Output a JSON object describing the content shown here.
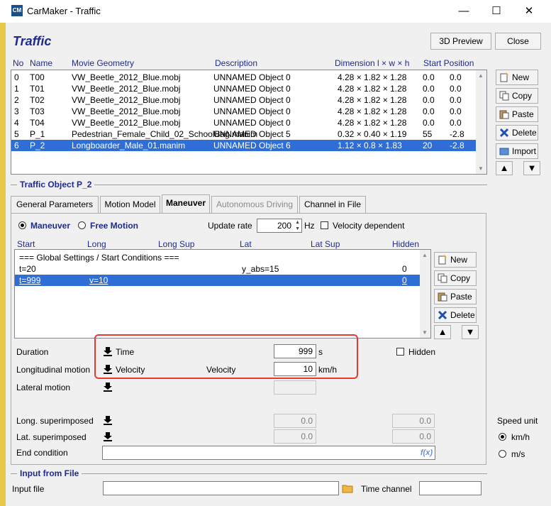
{
  "window": {
    "app_icon_text": "CM",
    "title": "CarMaker - Traffic",
    "minimize": "—",
    "maximize": "☐",
    "close": "✕"
  },
  "header": {
    "title": "Traffic",
    "preview_button": "3D Preview",
    "close_button": "Close"
  },
  "object_list": {
    "columns": [
      "No",
      "Name",
      "Movie Geometry",
      "Description",
      "Dimension l × w × h",
      "Start Position"
    ],
    "rows": [
      {
        "no": "0",
        "name": "T00",
        "movie": "VW_Beetle_2012_Blue.mobj",
        "desc": "UNNAMED Object 0",
        "dim": "4.28 × 1.82 × 1.28",
        "s1": "0.0",
        "s2": "0.0"
      },
      {
        "no": "1",
        "name": "T01",
        "movie": "VW_Beetle_2012_Blue.mobj",
        "desc": "UNNAMED Object 0",
        "dim": "4.28 × 1.82 × 1.28",
        "s1": "0.0",
        "s2": "0.0"
      },
      {
        "no": "2",
        "name": "T02",
        "movie": "VW_Beetle_2012_Blue.mobj",
        "desc": "UNNAMED Object 0",
        "dim": "4.28 × 1.82 × 1.28",
        "s1": "0.0",
        "s2": "0.0"
      },
      {
        "no": "3",
        "name": "T03",
        "movie": "VW_Beetle_2012_Blue.mobj",
        "desc": "UNNAMED Object 0",
        "dim": "4.28 × 1.82 × 1.28",
        "s1": "0.0",
        "s2": "0.0"
      },
      {
        "no": "4",
        "name": "T04",
        "movie": "VW_Beetle_2012_Blue.mobj",
        "desc": "UNNAMED Object 0",
        "dim": "4.28 × 1.82 × 1.28",
        "s1": "0.0",
        "s2": "0.0"
      },
      {
        "no": "5",
        "name": "P_1",
        "movie": "Pedestrian_Female_Child_02_SchoolBag.manim",
        "desc": "UNNAMED Object 5",
        "dim": "0.32 × 0.40 × 1.19",
        "s1": "55",
        "s2": "-2.8"
      },
      {
        "no": "6",
        "name": "P_2",
        "movie": "Longboarder_Male_01.manim",
        "desc": "UNNAMED Object 6",
        "dim": "1.12 × 0.8 × 1.83",
        "s1": "20",
        "s2": "-2.8"
      }
    ],
    "selected_index": 6
  },
  "side_buttons": {
    "new": "New",
    "copy": "Copy",
    "paste": "Paste",
    "delete": "Delete",
    "import": "Import"
  },
  "traffic_object": {
    "section_title": "Traffic Object P_2",
    "tabs": [
      "General Parameters",
      "Motion Model",
      "Maneuver",
      "Autonomous Driving",
      "Channel in File"
    ],
    "active_tab": "Maneuver",
    "disabled_tab": "Autonomous Driving"
  },
  "maneuver": {
    "radio_maneuver": "Maneuver",
    "radio_free": "Free Motion",
    "update_rate_label": "Update rate",
    "update_rate_value": "200",
    "update_rate_unit": "Hz",
    "velocity_dependent": "Velocity dependent",
    "grid_columns": [
      "Start",
      "Long",
      "Long Sup",
      "Lat",
      "Lat Sup",
      "Hidden"
    ],
    "grid_rows": [
      {
        "start": "=== Global Settings / Start Conditions ===",
        "long": "",
        "lat": "",
        "hidden": ""
      },
      {
        "start": "t=20",
        "long": "",
        "lat": "y_abs=15",
        "hidden": "0"
      },
      {
        "start": "t=999",
        "long": "v=10",
        "lat": "",
        "hidden": "0"
      }
    ],
    "grid_buttons": {
      "new": "New",
      "copy": "Copy",
      "paste": "Paste",
      "delete": "Delete"
    }
  },
  "detail": {
    "duration_label": "Duration",
    "duration_mode": "Time",
    "duration_value": "999",
    "duration_unit": "s",
    "hidden_label": "Hidden",
    "long_motion_label": "Longitudinal motion",
    "long_motion_mode": "Velocity",
    "velocity_label": "Velocity",
    "velocity_value": "10",
    "velocity_unit": "km/h",
    "lat_motion_label": "Lateral motion",
    "long_sup_label": "Long. superimposed",
    "long_sup_v1": "0.0",
    "long_sup_v2": "0.0",
    "lat_sup_label": "Lat. superimposed",
    "lat_sup_v1": "0.0",
    "lat_sup_v2": "0.0",
    "end_condition_label": "End condition",
    "fx_label": "f(x)"
  },
  "speed_unit": {
    "title": "Speed unit",
    "opt1": "km/h",
    "opt2": "m/s"
  },
  "input_file": {
    "section_title": "Input from File",
    "input_label": "Input file",
    "time_channel_label": "Time channel"
  },
  "colors": {
    "accent_blue": "#1e2a8e",
    "selection": "#2e6ed6",
    "highlight_box": "#e53a30"
  }
}
